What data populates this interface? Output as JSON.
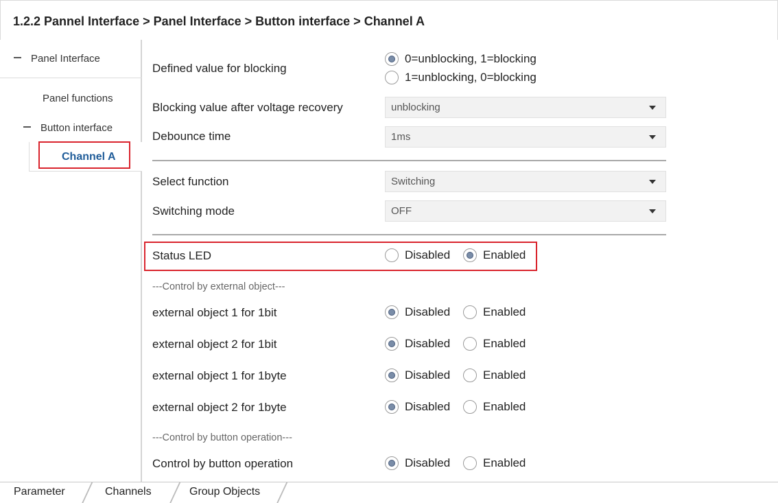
{
  "header": {
    "path": "1.2.2 Pannel Interface > Panel Interface > Button interface > Channel A"
  },
  "sidebar": {
    "items": [
      {
        "label": "Panel Interface"
      },
      {
        "label": "Panel functions"
      },
      {
        "label": "Button interface"
      },
      {
        "label": "Channel A",
        "selected": true
      }
    ]
  },
  "params": {
    "blocking_value": {
      "label": "Defined value for blocking",
      "options": [
        "0=unblocking, 1=blocking",
        "1=unblocking, 0=blocking"
      ],
      "selected": "0=unblocking, 1=blocking"
    },
    "blocking_after_recovery": {
      "label": "Blocking value after voltage recovery",
      "value": "unblocking"
    },
    "debounce_time": {
      "label": "Debounce time",
      "value": "1ms"
    },
    "select_function": {
      "label": "Select function",
      "value": "Switching"
    },
    "switching_mode": {
      "label": "Switching mode",
      "value": "OFF"
    },
    "status_led": {
      "label": "Status LED",
      "selected": "Enabled"
    },
    "external_note": "---Control by external object---",
    "ext_obj_1_1bit": {
      "label": "external object 1 for 1bit",
      "selected": "Disabled"
    },
    "ext_obj_2_1bit": {
      "label": "external object 2 for 1bit",
      "selected": "Disabled"
    },
    "ext_obj_1_1byte": {
      "label": "external object 1 for 1byte",
      "selected": "Disabled"
    },
    "ext_obj_2_1byte": {
      "label": "external object 2 for 1byte",
      "selected": "Disabled"
    },
    "button_note": "---Control by button operation---",
    "control_by_button": {
      "label": "Control by button operation",
      "selected": "Disabled"
    }
  },
  "radio_labels": {
    "disabled": "Disabled",
    "enabled": "Enabled"
  },
  "tabs": [
    {
      "label": "Parameter",
      "active": true
    },
    {
      "label": "Channels"
    },
    {
      "label": "Group Objects"
    }
  ],
  "colors": {
    "highlight": "#d9232c",
    "selected_text": "#1f5c99",
    "radio_fill": "#7a8da8"
  }
}
